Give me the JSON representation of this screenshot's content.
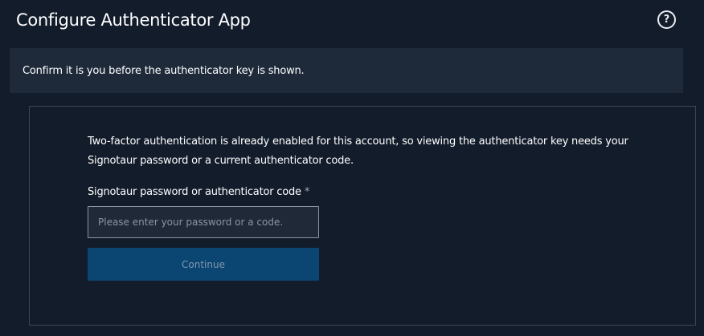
{
  "header": {
    "title": "Configure Authenticator App",
    "help_icon": "question-circle-icon",
    "help_glyph": "?"
  },
  "notice": {
    "text": "Confirm it is you before the authenticator key is shown."
  },
  "form": {
    "description": "Two-factor authentication is already enabled for this account, so viewing the authenticator key needs your Signotaur password or a current authenticator code.",
    "field_label": "Signotaur password or authenticator code",
    "required_mark": "*",
    "input_value": "",
    "input_placeholder": "Please enter your password or a code.",
    "continue_label": "Continue"
  },
  "colors": {
    "background": "#131c2b",
    "notice_background": "#1e2a3a",
    "panel_border": "#3a4658",
    "button_background": "#0b4572",
    "button_text": "#8098ae"
  }
}
